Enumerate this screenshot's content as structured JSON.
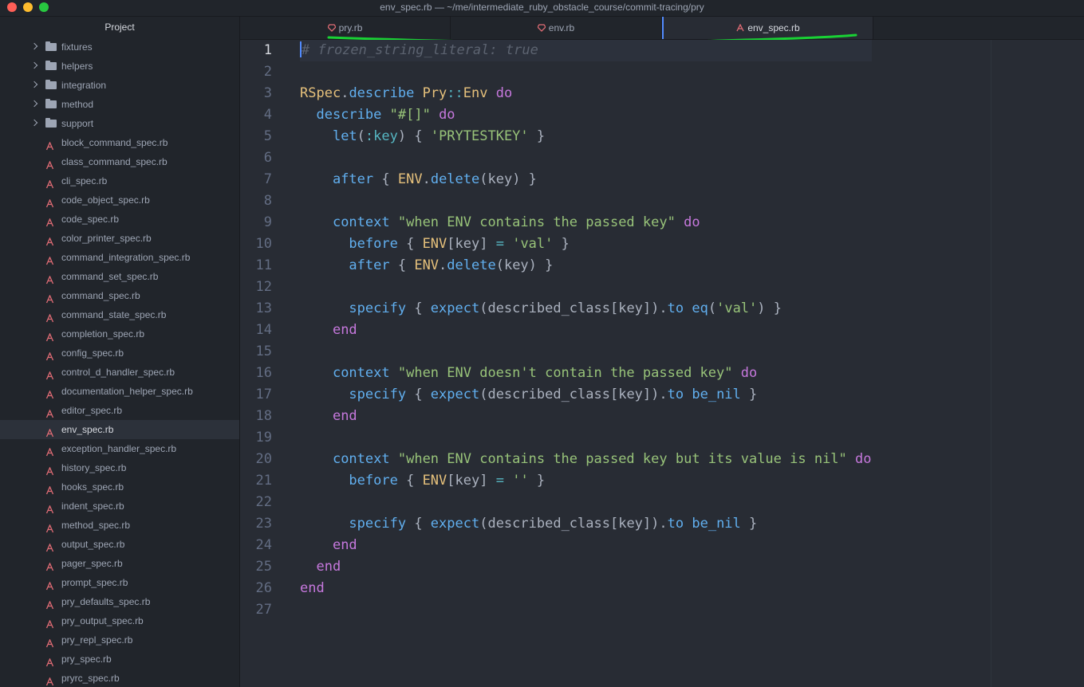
{
  "window": {
    "title": "env_spec.rb — ~/me/intermediate_ruby_obstacle_course/commit-tracing/pry"
  },
  "sidebar": {
    "header": "Project",
    "folders": [
      "fixtures",
      "helpers",
      "integration",
      "method",
      "support"
    ],
    "files": [
      "block_command_spec.rb",
      "class_command_spec.rb",
      "cli_spec.rb",
      "code_object_spec.rb",
      "code_spec.rb",
      "color_printer_spec.rb",
      "command_integration_spec.rb",
      "command_set_spec.rb",
      "command_spec.rb",
      "command_state_spec.rb",
      "completion_spec.rb",
      "config_spec.rb",
      "control_d_handler_spec.rb",
      "documentation_helper_spec.rb",
      "editor_spec.rb",
      "env_spec.rb",
      "exception_handler_spec.rb",
      "history_spec.rb",
      "hooks_spec.rb",
      "indent_spec.rb",
      "method_spec.rb",
      "output_spec.rb",
      "pager_spec.rb",
      "prompt_spec.rb",
      "pry_defaults_spec.rb",
      "pry_output_spec.rb",
      "pry_repl_spec.rb",
      "pry_spec.rb",
      "pryrc_spec.rb"
    ],
    "selected_file": "env_spec.rb"
  },
  "tabs": [
    {
      "label": "pry.rb",
      "icon": "ruby-icon"
    },
    {
      "label": "env.rb",
      "icon": "ruby-icon"
    },
    {
      "label": "env_spec.rb",
      "icon": "rspec-icon",
      "active": true
    }
  ],
  "editor": {
    "file": "env_spec.rb",
    "current_line": 1,
    "lines": [
      "# frozen_string_literal: true",
      "",
      "RSpec.describe Pry::Env do",
      "  describe \"#[]\" do",
      "    let(:key) { 'PRYTESTKEY' }",
      "",
      "    after { ENV.delete(key) }",
      "",
      "    context \"when ENV contains the passed key\" do",
      "      before { ENV[key] = 'val' }",
      "      after { ENV.delete(key) }",
      "",
      "      specify { expect(described_class[key]).to eq('val') }",
      "    end",
      "",
      "    context \"when ENV doesn't contain the passed key\" do",
      "      specify { expect(described_class[key]).to be_nil }",
      "    end",
      "",
      "    context \"when ENV contains the passed key but its value is nil\" do",
      "      before { ENV[key] = '' }",
      "",
      "      specify { expect(described_class[key]).to be_nil }",
      "    end",
      "  end",
      "end",
      ""
    ]
  },
  "colors": {
    "background": "#282c34",
    "panel": "#21252b",
    "keyword": "#c678dd",
    "constant": "#e5c07b",
    "function": "#61afef",
    "string": "#98c379",
    "symbol": "#56b6c2",
    "comment": "#5c6370",
    "accent": "#528bff",
    "annotation_stroke": "#19d234"
  }
}
